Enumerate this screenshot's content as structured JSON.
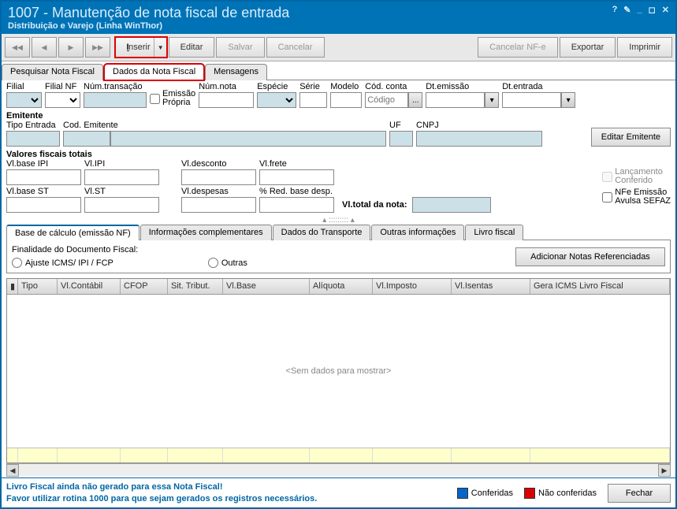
{
  "title": "1007 - Manutenção de nota fiscal de entrada",
  "subtitle": "Distribuição e Varejo (Linha WinThor)",
  "winControls": {
    "help": "?",
    "edit": "✎",
    "min": "_",
    "restore": "◻",
    "close": "✕"
  },
  "toolbar": {
    "inserir": "Inserir",
    "editar": "Editar",
    "salvar": "Salvar",
    "cancelar": "Cancelar",
    "cancelarnfe": "Cancelar NF-e",
    "exportar": "Exportar",
    "imprimir": "Imprimir"
  },
  "mainTabs": {
    "pesquisar": "Pesquisar Nota Fiscal",
    "dados": "Dados da Nota Fiscal",
    "mensagens": "Mensagens"
  },
  "labels": {
    "filial": "Filial",
    "filialnf": "Filial NF",
    "numtrans": "Núm.transação",
    "emissaopropria": "Emissão Própria",
    "numnota": "Núm.nota",
    "especie": "Espécie",
    "serie": "Série",
    "modelo": "Modelo",
    "codconta": "Cód. conta",
    "codigoPlaceholder": "Código",
    "dtemissao": "Dt.emissão",
    "dtentrada": "Dt.entrada",
    "emitente": "Emitente",
    "tipoentrada": "Tipo Entrada",
    "codemitente": "Cod. Emitente",
    "uf": "UF",
    "cnpj": "CNPJ",
    "editaremitente": "Editar Emitente",
    "valoresfiscais": "Valores fiscais totais",
    "vlbaseipi": "Vl.base IPI",
    "vlipi": "Vl.IPI",
    "vldesconto": "Vl.desconto",
    "vlfrete": "Vl.frete",
    "vlbasest": "Vl.base ST",
    "vlst": "Vl.ST",
    "vldespesas": "Vl.despesas",
    "pctred": "% Red. base desp.",
    "vltotalnota": "Vl.total da nota:",
    "lancConferido": "Lançamento Conferido",
    "nfeAvulsa": "NFe Emissão Avulsa SEFAZ"
  },
  "subTabs": {
    "base": "Base de cálculo (emissão NF)",
    "info": "Informações complementares",
    "transp": "Dados do Transporte",
    "outras": "Outras informações",
    "livro": "Livro fiscal"
  },
  "docFinal": {
    "label": "Finalidade do Documento Fiscal:",
    "ajuste": "Ajuste ICMS/ IPI / FCP",
    "outras": "Outras",
    "adicionar": "Adicionar Notas Referenciadas"
  },
  "gridCols": {
    "tipo": "Tipo",
    "vlcontabil": "Vl.Contábil",
    "cfop": "CFOP",
    "sittribut": "Sit. Tribut.",
    "vlbase": "Vl.Base",
    "aliquota": "Alíquota",
    "vlimposto": "Vl.Imposto",
    "vlisentas": "Vl.Isentas",
    "geraicms": "Gera ICMS Livro Fiscal"
  },
  "gridEmpty": "<Sem dados para mostrar>",
  "footerMsg1": "Livro Fiscal ainda não gerado para essa Nota Fiscal!",
  "footerMsg2": "Favor utilizar rotina 1000 para que sejam gerados os registros necessários.",
  "legend": {
    "conferidas": "Conferidas",
    "naoconferidas": "Não conferidas"
  },
  "fechar": "Fechar"
}
